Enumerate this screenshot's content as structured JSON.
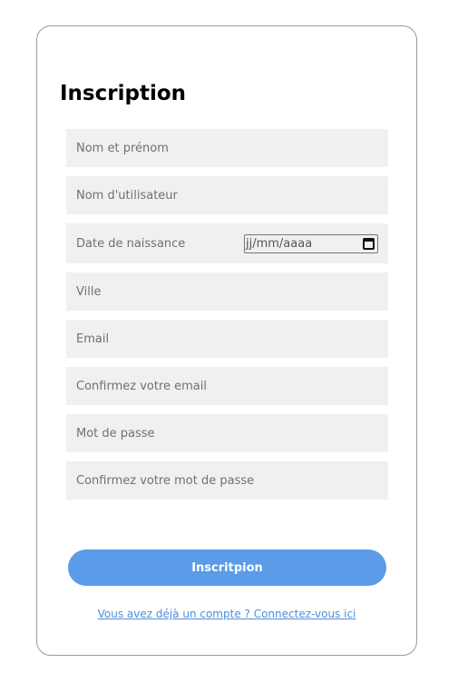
{
  "form": {
    "title": "Inscription",
    "fields": {
      "full_name": {
        "placeholder": "Nom et prénom",
        "value": ""
      },
      "username": {
        "placeholder": "Nom d'utilisateur",
        "value": ""
      },
      "birthdate": {
        "label": "Date de naissance",
        "placeholder": "jj/mm/aaaa"
      },
      "city": {
        "placeholder": "Ville",
        "value": ""
      },
      "email": {
        "placeholder": "Email",
        "value": ""
      },
      "email_confirm": {
        "placeholder": "Confirmez votre email",
        "value": ""
      },
      "password": {
        "placeholder": "Mot de passe",
        "value": ""
      },
      "password_confirm": {
        "placeholder": "Confirmez votre mot de passe",
        "value": ""
      }
    },
    "submit_label": "Inscritpion",
    "login_link": "Vous avez déjà un compte ? Connectez-vous ici"
  },
  "colors": {
    "accent": "#5b9be8",
    "field_background": "#f0f0f0",
    "link": "#4a8fe0",
    "card_border": "#9a9a9a"
  },
  "icons": {
    "date_picker": "calendar-icon"
  }
}
